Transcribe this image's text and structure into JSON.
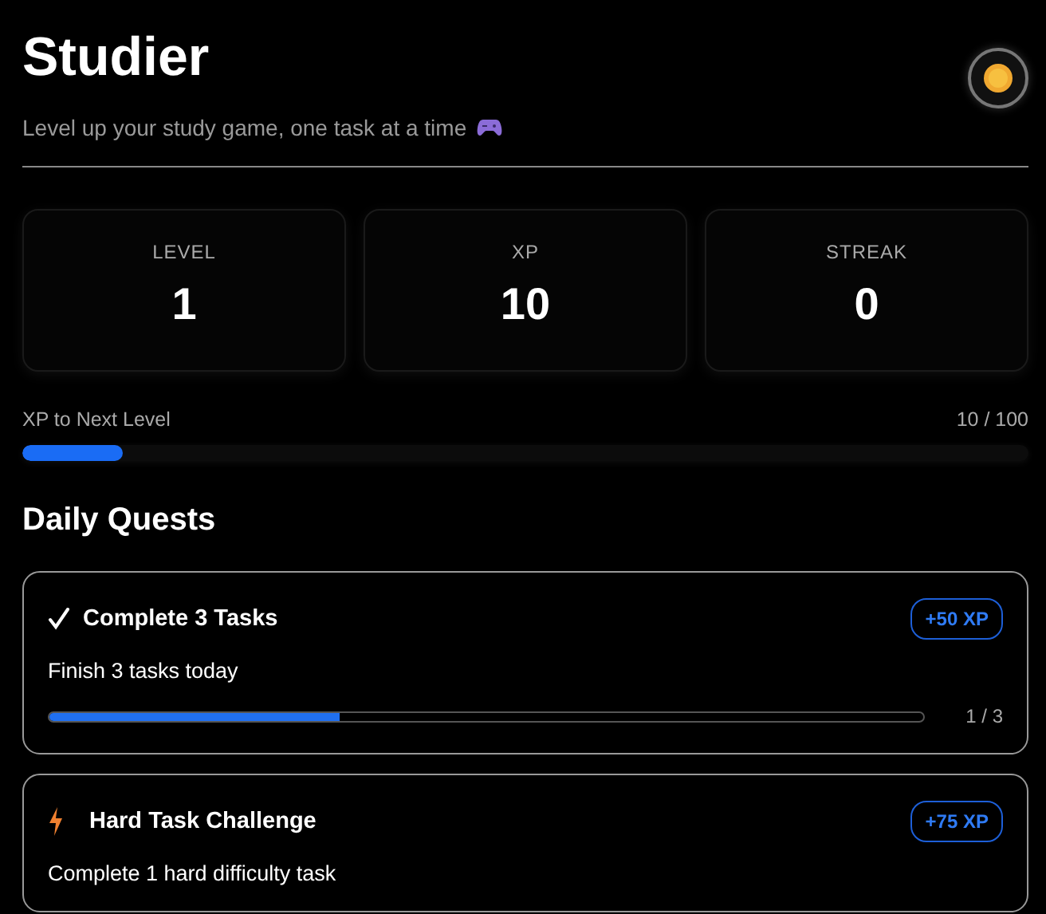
{
  "header": {
    "title": "Studier",
    "subtitle": "Level up your study game, one task at a time"
  },
  "stats": [
    {
      "label": "LEVEL",
      "value": "1"
    },
    {
      "label": "XP",
      "value": "10"
    },
    {
      "label": "STREAK",
      "value": "0"
    }
  ],
  "xp_progress": {
    "label": "XP to Next Level",
    "reading": "10 / 100",
    "level": 0.1
  },
  "quests_title": "Daily Quests",
  "quests": [
    {
      "kind": "check",
      "title": "Complete 3 Tasks",
      "reward": "+50 XP",
      "description": "Finish 3 tasks today",
      "level": 0.333,
      "reading": "1 / 3"
    },
    {
      "kind": "bolt",
      "title": "Hard Task Challenge",
      "reward": "+75 XP",
      "description": "Complete 1 hard difficulty task"
    }
  ]
}
